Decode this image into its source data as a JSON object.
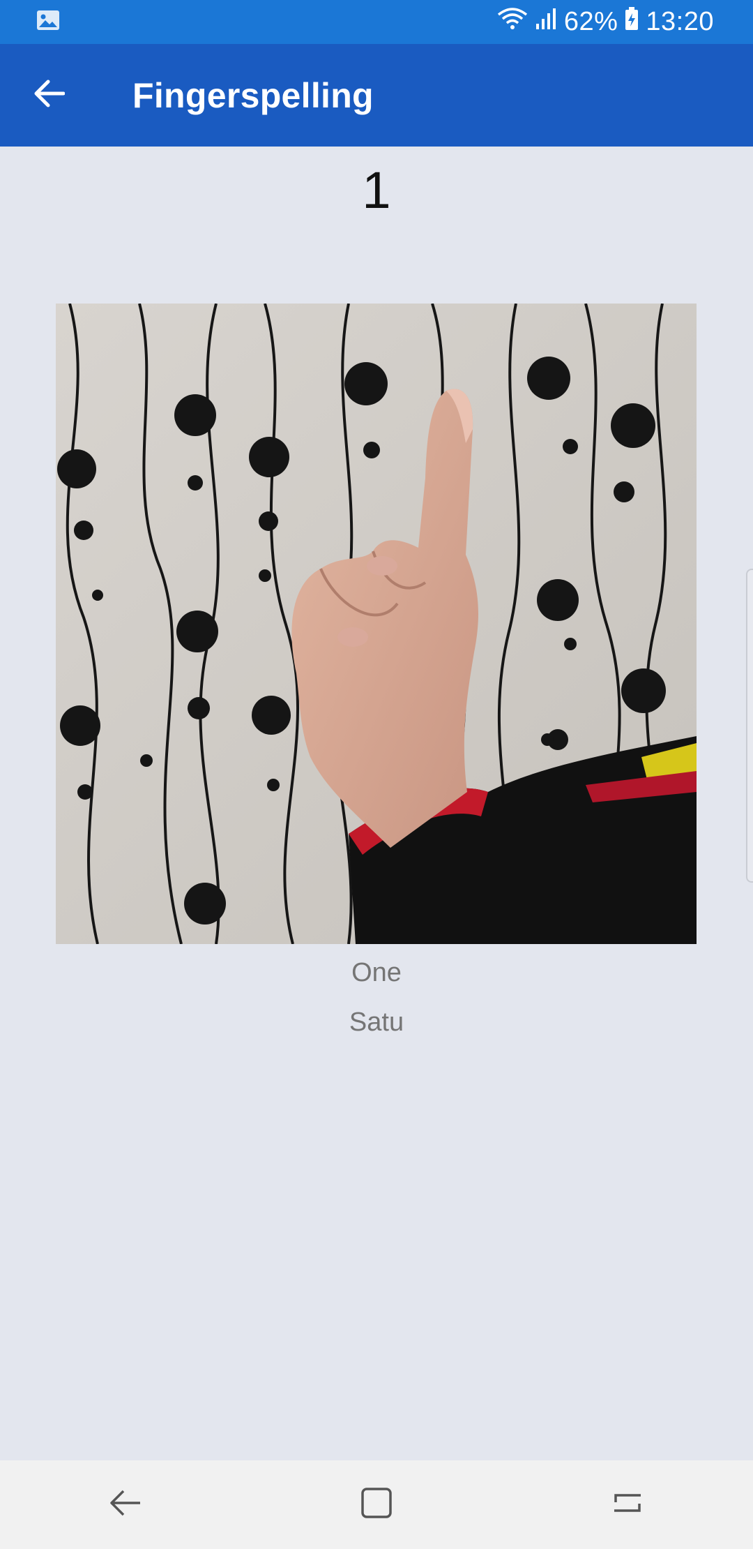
{
  "status_bar": {
    "notification_icon": "image-icon",
    "battery": "62%",
    "time": "13:20"
  },
  "app_bar": {
    "title": "Fingerspelling",
    "back_icon": "arrow-left-icon"
  },
  "content": {
    "number": "1",
    "image_alt": "hand sign",
    "caption_english": "One",
    "caption_malay": "Satu"
  },
  "nav_bar": {
    "back_icon": "nav-back-icon",
    "home_icon": "nav-home-icon",
    "recents_icon": "nav-recents-icon"
  },
  "colors": {
    "status_bar": "#1b77d6",
    "app_bar": "#1a5bc1",
    "background": "#e3e6ee"
  }
}
